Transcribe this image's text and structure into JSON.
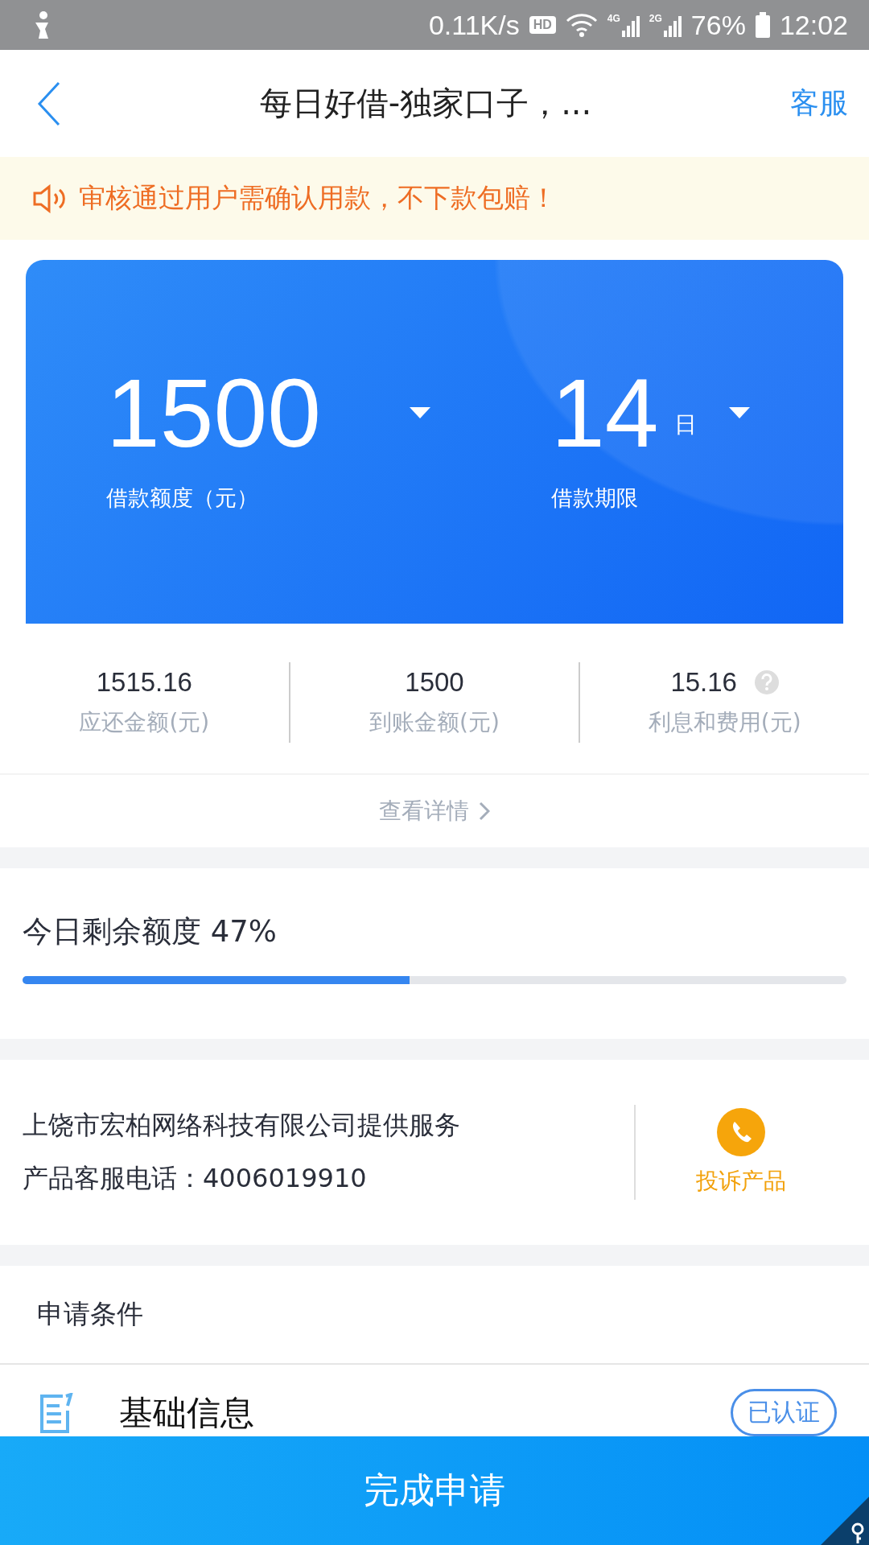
{
  "status_bar": {
    "speed": "0.11K/s",
    "hd": "HD",
    "signals": [
      "4G",
      "2G"
    ],
    "battery": "76%",
    "time": "12:02"
  },
  "header": {
    "title": "每日好借-独家口子，...",
    "action": "客服"
  },
  "notice": {
    "text": "审核通过用户需确认用款，不下款包赔！"
  },
  "loan": {
    "amount": "1500",
    "amount_label": "借款额度（元）",
    "term": "14",
    "term_unit": "日",
    "term_label": "借款期限"
  },
  "summary": {
    "items": [
      {
        "value": "1515.16",
        "label": "应还金额(元)",
        "help": false
      },
      {
        "value": "1500",
        "label": "到账金额(元)",
        "help": false
      },
      {
        "value": "15.16",
        "label": "利息和费用(元)",
        "help": true
      }
    ],
    "details_link": "查看详情"
  },
  "quota": {
    "label": "今日剩余额度",
    "percent": "47%",
    "level": 0.47
  },
  "provider": {
    "company": "上饶市宏柏网络科技有限公司提供服务",
    "phone": "产品客服电话：4006019910",
    "complaint": "投诉产品"
  },
  "conditions": {
    "title": "申请条件",
    "items": [
      {
        "name": "基础信息",
        "status": "已认证",
        "verified": true
      }
    ]
  },
  "submit": "完成申请"
}
